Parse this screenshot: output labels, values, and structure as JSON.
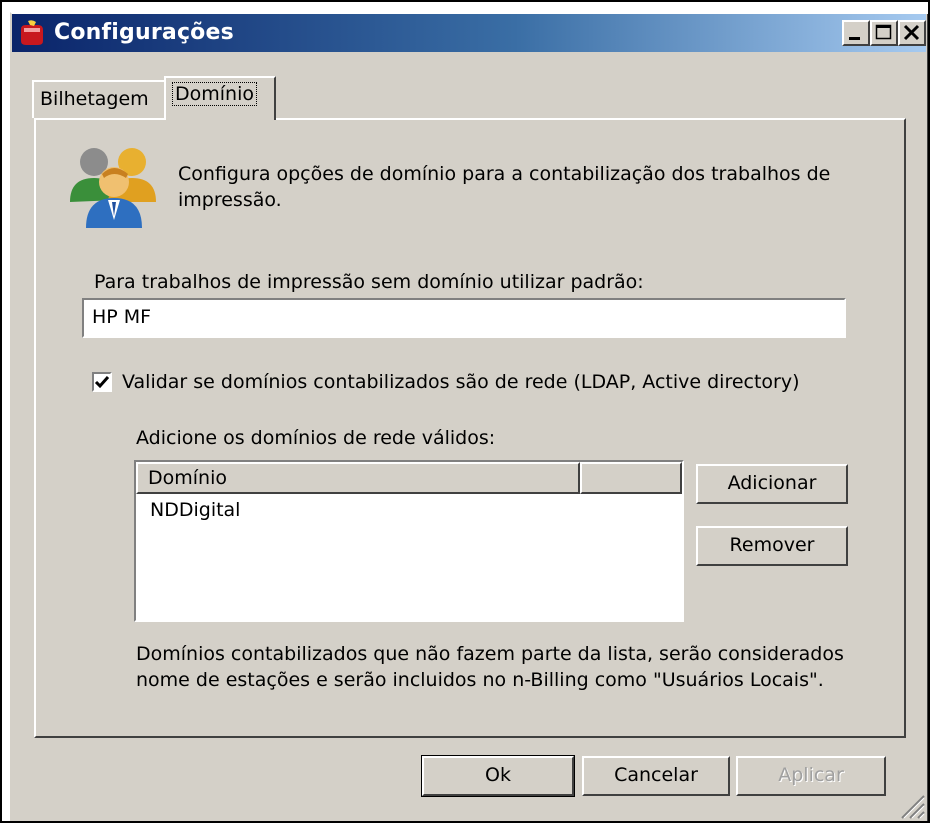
{
  "window": {
    "title": "Configurações",
    "minimize_icon": "minimize-icon",
    "maximize_icon": "maximize-icon",
    "close_icon": "close-icon"
  },
  "tabs": [
    {
      "label": "Bilhetagem",
      "active": false
    },
    {
      "label": "Domínio",
      "active": true
    }
  ],
  "panel": {
    "icon": "users-group-icon",
    "description_line1": "Configura opções de domínio para a contabilização dos trabalhos de",
    "description_line2": "impressão.",
    "default_domain_label": "Para trabalhos de impressão sem domínio utilizar padrão:",
    "default_domain_value": "HP MF",
    "validate_checkbox_label": "Validar se domínios contabilizados são de rede (LDAP, Active directory)",
    "validate_checked": true,
    "valid_domains_label": "Adicione os domínios de rede válidos:",
    "domains_table": {
      "columns": [
        "Domínio",
        ""
      ],
      "rows": [
        "NDDigital"
      ]
    },
    "add_button": "Adicionar",
    "remove_button": "Remover",
    "footnote_line1": "Domínios contabilizados que não fazem parte da lista, serão considerados",
    "footnote_line2": "nome de estações e serão incluidos no n-Billing como \"Usuários Locais\"."
  },
  "footer": {
    "ok_button": "Ok",
    "cancel_button": "Cancelar",
    "apply_button": "Aplicar",
    "apply_enabled": false
  },
  "colors": {
    "titlebar_start": "#0a246a",
    "titlebar_end": "#a6caf0",
    "face": "#d4d0c8"
  }
}
